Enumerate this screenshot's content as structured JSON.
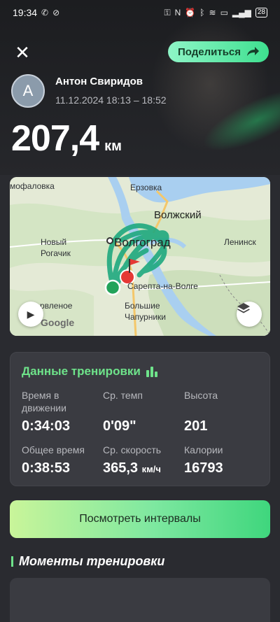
{
  "status_bar": {
    "time": "19:34",
    "battery": "28"
  },
  "header": {
    "share_label": "Поделиться"
  },
  "user": {
    "avatar_letter": "A",
    "name": "Антон Свиридов",
    "datetime": "11.12.2024 18:13 – 18:52"
  },
  "workout": {
    "distance": "207,4",
    "distance_unit": "км"
  },
  "map": {
    "labels": {
      "erzovka": "Ерзовка",
      "mofalovka": "мофаловка",
      "volzhsky": "Волжский",
      "novy_rogachik_1": "Новый",
      "novy_rogachik_2": "Рогачик",
      "volgograd": "Волгоград",
      "leninsk": "Ленинск",
      "sarepta": "Сарепта-на-Волге",
      "ovrazhnoe": "рвленое",
      "bolshie_1": "Большие",
      "bolshie_2": "Чапурники",
      "google": "Google"
    },
    "route_color": "#1fa97f",
    "start_color": "#22a35a",
    "finish_color": "#e53935"
  },
  "stats": {
    "title": "Данные тренировки",
    "accent_color": "#6ee38a",
    "items": [
      {
        "label": "Время в движении",
        "value": "0:34:03",
        "unit": ""
      },
      {
        "label": "Ср. темп",
        "value": "0'09\"",
        "unit": ""
      },
      {
        "label": "Высота",
        "value": "201",
        "unit": ""
      },
      {
        "label": "Общее время",
        "value": "0:38:53",
        "unit": ""
      },
      {
        "label": "Ср. скорость",
        "value": "365,3",
        "unit": "км/ч"
      },
      {
        "label": "Калории",
        "value": "16793",
        "unit": ""
      }
    ]
  },
  "intervals_button": {
    "label": "Посмотреть интервалы"
  },
  "moments": {
    "title": "Моменты тренировки"
  }
}
